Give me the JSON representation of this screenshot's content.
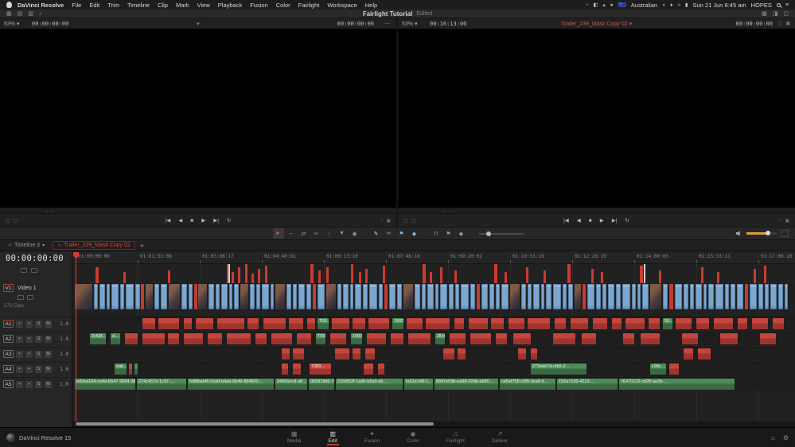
{
  "colors": {
    "accent": "#c9392c",
    "clip_blue": "#7ba6cd",
    "clip_red": "#c23c34",
    "clip_green": "#4d8c57",
    "volume_orange": "#de9a3f",
    "active_tab_red": "#cf4a3e"
  },
  "glyphs": {
    "caret": "▾",
    "dots": "⋯",
    "plus": "+",
    "close": "✕",
    "menu": "≡",
    "scrub": "‹ ›",
    "box": "▢",
    "circle": "○",
    "square": "▣"
  },
  "menubar": {
    "items": [
      "DaVinci Resolve",
      "File",
      "Edit",
      "Trim",
      "Timeline",
      "Clip",
      "Mark",
      "View",
      "Playback",
      "Fusion",
      "Color",
      "Fairlight",
      "Workspace",
      "Help"
    ],
    "status_icons_a": [
      {
        "name": "time-machine-icon",
        "glyph": "◔"
      },
      {
        "name": "display-icon",
        "glyph": "◧"
      },
      {
        "name": "dropbox-icon",
        "glyph": "▴"
      },
      {
        "name": "vpn-status-icon",
        "glyph": "●"
      }
    ],
    "region": "Australian",
    "status_icons_b": [
      {
        "name": "volume-icon",
        "glyph": "◖"
      },
      {
        "name": "bluetooth-icon",
        "glyph": "♦"
      },
      {
        "name": "wifi-icon",
        "glyph": "≈"
      },
      {
        "name": "battery-icon",
        "glyph": "▮"
      }
    ],
    "datetime": "Sun 21 Jun 8:45 am",
    "user": "HOPES"
  },
  "titlebar": {
    "title": "Fairlight Tutorial",
    "status": "Edited",
    "left_icons": [
      {
        "name": "media-pool-icon",
        "glyph": "▦"
      },
      {
        "name": "effects-library-icon",
        "glyph": "▤"
      },
      {
        "name": "edit-index-icon",
        "glyph": "▥"
      },
      {
        "name": "sound-library-icon",
        "glyph": "♪"
      }
    ],
    "right_icons": [
      {
        "name": "mixer-icon",
        "glyph": "▩"
      },
      {
        "name": "metadata-icon",
        "glyph": "◨"
      },
      {
        "name": "inspector-icon",
        "glyph": "◫"
      }
    ]
  },
  "viewers": {
    "left": {
      "zoom": "53%",
      "tc_in": "00:00:00:00",
      "tc_out": "00:00:00:00"
    },
    "right": {
      "zoom": "53%",
      "tc_in": "00:16:13:06",
      "clip": "Trailer_239_Mask Copy 02",
      "tc_out": "00:00:00:00"
    }
  },
  "transport": [
    {
      "name": "jump-to-start-button",
      "glyph": "|◀"
    },
    {
      "name": "step-back-button",
      "glyph": "◀"
    },
    {
      "name": "stop-button",
      "glyph": "■"
    },
    {
      "name": "play-button",
      "glyph": "▶"
    },
    {
      "name": "step-forward-button",
      "glyph": "▶|"
    },
    {
      "name": "loop-button",
      "glyph": "↻"
    }
  ],
  "toolbar": {
    "tools": [
      {
        "name": "selection-mode-tool",
        "glyph": "►",
        "color": "#d6594c",
        "active": true
      },
      {
        "name": "trim-edit-mode-tool",
        "glyph": "↔"
      },
      {
        "name": "dynamic-trim-mode-tool",
        "glyph": "⇄"
      },
      {
        "name": "blade-edit-mode-tool",
        "glyph": "✄"
      },
      {
        "name": "insert-clip-button",
        "glyph": "↓"
      },
      {
        "name": "overwrite-clip-button",
        "glyph": "▼"
      },
      {
        "name": "replace-clip-button",
        "glyph": "◉"
      },
      {
        "name": "pen-keyframe-tool",
        "glyph": "✎",
        "color": "#d8d8d8",
        "gap": true
      },
      {
        "name": "link-clips-toggle",
        "glyph": "∞",
        "color": "#86b6e8"
      },
      {
        "name": "flag-clip-button",
        "glyph": "⚑",
        "color": "#86b6e8"
      },
      {
        "name": "marker-button",
        "glyph": "◆",
        "color": "#86b6e8"
      },
      {
        "name": "snapping-toggle",
        "glyph": "⊓",
        "gap": true
      },
      {
        "name": "flag-color-button",
        "glyph": "⚑"
      },
      {
        "name": "marker-color-button",
        "glyph": "◆"
      }
    ]
  },
  "tabs": [
    {
      "label": "Timeline 3",
      "active": false
    },
    {
      "label": "Trailer_239_Mask Copy 02",
      "active": true
    }
  ],
  "timeline": {
    "timecode": "00:00:00:00",
    "ruler": [
      "01:00:00:00",
      "01:01:33:08",
      "01:03:06:17",
      "01:04:40:01",
      "01:06:13:10",
      "01:07:46:18",
      "01:09:20:02",
      "01:10:53:10",
      "01:12:26:19",
      "01:14:00:03",
      "01:15:33:11",
      "01:17:06:20"
    ],
    "video_track": {
      "badge": "V1",
      "name": "Video 1",
      "clip_count": "175 Clips"
    },
    "track_buttons": [
      {
        "name": "lock",
        "glyph": "•"
      },
      {
        "name": "record-arm",
        "glyph": "▪"
      },
      {
        "name": "solo",
        "glyph": "S"
      },
      {
        "name": "mute",
        "glyph": "M"
      }
    ],
    "audio_tracks": [
      {
        "badge": "A1",
        "gain": "1.0",
        "selected": true
      },
      {
        "badge": "A2",
        "gain": "1.0",
        "selected": false
      },
      {
        "badge": "A3",
        "gain": "1.0",
        "selected": false
      },
      {
        "badge": "A4",
        "gain": "1.0",
        "selected": false
      },
      {
        "badge": "A5",
        "gain": "1.0",
        "selected": false
      }
    ],
    "markers": [
      [
        29,
        4,
        20
      ],
      [
        64,
        3,
        14
      ],
      [
        120,
        3,
        16
      ],
      [
        194,
        4,
        24
      ],
      [
        200,
        3,
        14
      ],
      [
        208,
        3,
        20
      ],
      [
        217,
        3,
        24
      ],
      [
        225,
        3,
        12
      ],
      [
        233,
        3,
        18
      ],
      [
        242,
        3,
        22
      ],
      [
        299,
        4,
        24
      ],
      [
        309,
        3,
        16
      ],
      [
        319,
        3,
        20
      ],
      [
        350,
        3,
        24
      ],
      [
        360,
        3,
        14
      ],
      [
        368,
        3,
        18
      ],
      [
        390,
        3,
        22
      ],
      [
        440,
        4,
        24
      ],
      [
        449,
        3,
        14
      ],
      [
        462,
        3,
        20
      ],
      [
        480,
        3,
        16
      ],
      [
        530,
        4,
        24
      ],
      [
        543,
        3,
        14
      ],
      [
        570,
        3,
        20
      ],
      [
        592,
        3,
        16
      ],
      [
        622,
        4,
        24
      ],
      [
        652,
        3,
        18
      ],
      [
        664,
        3,
        14
      ],
      [
        713,
        4,
        22
      ],
      [
        737,
        3,
        16
      ],
      [
        790,
        3,
        20
      ],
      [
        810,
        3,
        14
      ],
      [
        856,
        3,
        18
      ],
      [
        869,
        3,
        22
      ]
    ],
    "markers_light": [
      [
        196,
        2,
        24
      ],
      [
        718,
        2,
        24
      ]
    ],
    "video_clips": [
      [
        3,
        22,
        "t"
      ],
      [
        27,
        5,
        "b"
      ],
      [
        34,
        7,
        "b"
      ],
      [
        43,
        4,
        "b"
      ],
      [
        49,
        9,
        "b"
      ],
      [
        60,
        5,
        "b"
      ],
      [
        67,
        10,
        "b"
      ],
      [
        79,
        6,
        "b"
      ],
      [
        86,
        4,
        "r"
      ],
      [
        92,
        9,
        "t"
      ],
      [
        103,
        6,
        "b"
      ],
      [
        111,
        8,
        "b"
      ],
      [
        121,
        14,
        "t"
      ],
      [
        137,
        7,
        "b"
      ],
      [
        146,
        5,
        "b"
      ],
      [
        153,
        4,
        "r"
      ],
      [
        158,
        11,
        "t"
      ],
      [
        171,
        7,
        "b"
      ],
      [
        180,
        5,
        "b"
      ],
      [
        187,
        8,
        "b"
      ],
      [
        197,
        4,
        "b"
      ],
      [
        203,
        6,
        "b"
      ],
      [
        211,
        10,
        "t"
      ],
      [
        223,
        6,
        "b"
      ],
      [
        231,
        5,
        "b"
      ],
      [
        238,
        9,
        "b"
      ],
      [
        249,
        4,
        "b"
      ],
      [
        255,
        12,
        "t"
      ],
      [
        269,
        6,
        "b"
      ],
      [
        277,
        5,
        "b"
      ],
      [
        284,
        8,
        "b"
      ],
      [
        294,
        6,
        "b"
      ],
      [
        302,
        4,
        "r"
      ],
      [
        308,
        9,
        "b"
      ],
      [
        319,
        12,
        "t"
      ],
      [
        333,
        5,
        "b"
      ],
      [
        340,
        7,
        "b"
      ],
      [
        349,
        4,
        "b"
      ],
      [
        355,
        8,
        "b"
      ],
      [
        365,
        6,
        "b"
      ],
      [
        373,
        10,
        "b"
      ],
      [
        385,
        5,
        "b"
      ],
      [
        392,
        4,
        "r"
      ],
      [
        398,
        8,
        "b"
      ],
      [
        408,
        6,
        "b"
      ],
      [
        416,
        12,
        "t"
      ],
      [
        430,
        7,
        "b"
      ],
      [
        439,
        5,
        "b"
      ],
      [
        446,
        8,
        "b"
      ],
      [
        456,
        4,
        "b"
      ],
      [
        462,
        9,
        "b"
      ],
      [
        473,
        6,
        "b"
      ],
      [
        481,
        5,
        "b"
      ],
      [
        488,
        10,
        "b"
      ],
      [
        500,
        6,
        "b"
      ],
      [
        508,
        4,
        "r"
      ],
      [
        514,
        8,
        "b"
      ],
      [
        524,
        6,
        "b"
      ],
      [
        532,
        5,
        "b"
      ],
      [
        539,
        9,
        "b"
      ],
      [
        550,
        12,
        "t"
      ],
      [
        564,
        6,
        "b"
      ],
      [
        572,
        5,
        "b"
      ],
      [
        579,
        8,
        "b"
      ],
      [
        589,
        4,
        "b"
      ],
      [
        595,
        7,
        "b"
      ],
      [
        604,
        10,
        "b"
      ],
      [
        616,
        5,
        "b"
      ],
      [
        623,
        6,
        "b"
      ],
      [
        631,
        8,
        "t"
      ],
      [
        641,
        4,
        "r"
      ],
      [
        647,
        9,
        "b"
      ],
      [
        658,
        6,
        "b"
      ],
      [
        666,
        5,
        "b"
      ],
      [
        673,
        8,
        "b"
      ],
      [
        683,
        6,
        "b"
      ],
      [
        691,
        10,
        "b"
      ],
      [
        703,
        5,
        "b"
      ],
      [
        710,
        4,
        "b"
      ],
      [
        716,
        8,
        "b"
      ],
      [
        726,
        14,
        "t"
      ],
      [
        742,
        6,
        "b"
      ],
      [
        750,
        5,
        "r"
      ],
      [
        757,
        9,
        "b"
      ],
      [
        768,
        6,
        "b"
      ],
      [
        776,
        5,
        "b"
      ],
      [
        783,
        8,
        "b"
      ],
      [
        793,
        4,
        "b"
      ],
      [
        799,
        7,
        "b"
      ],
      [
        808,
        10,
        "b"
      ],
      [
        820,
        5,
        "b"
      ],
      [
        827,
        6,
        "b"
      ],
      [
        835,
        8,
        "b"
      ],
      [
        845,
        4,
        "r"
      ],
      [
        851,
        9,
        "b"
      ],
      [
        862,
        6,
        "b"
      ],
      [
        870,
        5,
        "b"
      ],
      [
        877,
        8,
        "b"
      ],
      [
        887,
        6,
        "b"
      ],
      [
        895,
        4,
        "b"
      ]
    ],
    "audio_clips": {
      "a1": [
        [
          88,
          16,
          "r"
        ],
        [
          108,
          26,
          "r"
        ],
        [
          140,
          10,
          "r"
        ],
        [
          155,
          22,
          "r"
        ],
        [
          182,
          34,
          "r"
        ],
        [
          220,
          14,
          "r"
        ],
        [
          240,
          28,
          "r"
        ],
        [
          272,
          18,
          "r"
        ],
        [
          295,
          10,
          "r"
        ],
        [
          308,
          14,
          "g",
          "T03..."
        ],
        [
          326,
          22,
          "r"
        ],
        [
          352,
          16,
          "r"
        ],
        [
          372,
          26,
          "r"
        ],
        [
          402,
          14,
          "g",
          "1902..."
        ],
        [
          420,
          20,
          "r"
        ],
        [
          444,
          30,
          "r"
        ],
        [
          480,
          12,
          "r"
        ],
        [
          498,
          24,
          "r"
        ],
        [
          526,
          16,
          "r"
        ],
        [
          548,
          20,
          "r"
        ],
        [
          572,
          28,
          "r"
        ],
        [
          606,
          14,
          "r"
        ],
        [
          626,
          22,
          "r"
        ],
        [
          654,
          18,
          "r"
        ],
        [
          678,
          12,
          "r"
        ],
        [
          695,
          24,
          "r"
        ],
        [
          724,
          14,
          "r"
        ],
        [
          742,
          12,
          "g",
          "55..."
        ],
        [
          758,
          20,
          "r"
        ],
        [
          784,
          16,
          "r"
        ],
        [
          806,
          24,
          "r"
        ],
        [
          836,
          12,
          "r"
        ],
        [
          854,
          20,
          "r"
        ],
        [
          880,
          14,
          "r"
        ]
      ],
      "a2": [
        [
          22,
          20,
          "g",
          "2c66f..."
        ],
        [
          48,
          12,
          "g",
          "d..."
        ],
        [
          66,
          16,
          "r"
        ],
        [
          88,
          28,
          "r"
        ],
        [
          120,
          14,
          "r"
        ],
        [
          140,
          24,
          "r"
        ],
        [
          170,
          18,
          "r"
        ],
        [
          194,
          30,
          "r"
        ],
        [
          230,
          14,
          "r"
        ],
        [
          250,
          26,
          "r"
        ],
        [
          282,
          18,
          "r"
        ],
        [
          306,
          12,
          "g",
          "T03..."
        ],
        [
          324,
          20,
          "r"
        ],
        [
          350,
          14,
          "g",
          "1902..."
        ],
        [
          370,
          24,
          "r"
        ],
        [
          400,
          16,
          "r"
        ],
        [
          422,
          28,
          "r"
        ],
        [
          456,
          12,
          "g",
          "26c0..."
        ],
        [
          474,
          20,
          "r"
        ],
        [
          500,
          26,
          "r"
        ],
        [
          532,
          14,
          "r"
        ],
        [
          554,
          22,
          "r"
        ],
        [
          604,
          28,
          "r"
        ],
        [
          640,
          18,
          "r"
        ],
        [
          692,
          14,
          "r"
        ],
        [
          714,
          24,
          "r"
        ],
        [
          766,
          20,
          "r"
        ],
        [
          814,
          22,
          "r"
        ],
        [
          864,
          20,
          "r"
        ]
      ],
      "a3": [
        [
          263,
          10,
          "r"
        ],
        [
          277,
          14,
          "r"
        ],
        [
          330,
          18,
          "r"
        ],
        [
          352,
          10,
          "r"
        ],
        [
          368,
          12,
          "r"
        ],
        [
          466,
          14,
          "r"
        ],
        [
          484,
          10,
          "r"
        ],
        [
          560,
          10,
          "r"
        ],
        [
          576,
          8,
          "r"
        ],
        [
          768,
          12,
          "r"
        ],
        [
          786,
          16,
          "r"
        ]
      ],
      "a4": [
        [
          53,
          15,
          "g",
          "eab..."
        ],
        [
          71,
          4,
          "r"
        ],
        [
          78,
          4,
          "g"
        ],
        [
          263,
          8,
          "r"
        ],
        [
          277,
          10,
          "r"
        ],
        [
          298,
          27,
          "r",
          "7389..."
        ],
        [
          366,
          12,
          "r"
        ],
        [
          384,
          8,
          "r"
        ],
        [
          576,
          70,
          "g",
          "273eb67d-cfb5-2..."
        ],
        [
          726,
          20,
          "g",
          "c28c..."
        ],
        [
          750,
          12,
          "r"
        ]
      ],
      "a5": [
        [
          3,
          76,
          "g",
          "e42ea164-ce4a-b547-9994-3862..."
        ],
        [
          81,
          62,
          "g",
          "274c457d-1c97-..."
        ],
        [
          145,
          108,
          "g",
          "5d88ad46-0cdd-b4ab-0b49-884600..."
        ],
        [
          255,
          40,
          "g",
          "24665ecd-a8..."
        ],
        [
          297,
          32,
          "g",
          "065918d6-75..."
        ],
        [
          331,
          84,
          "g",
          "21b0f52f-1ad6-b5a9-a6..."
        ],
        [
          417,
          36,
          "g",
          "fa62e148-1..."
        ],
        [
          455,
          80,
          "g",
          "88d7e09b-ea98-92db-a680..."
        ],
        [
          537,
          70,
          "g",
          "ce5ef758-c0f9-3ea0-6..."
        ],
        [
          609,
          76,
          "g",
          "192a7165-4212-..."
        ],
        [
          687,
          145,
          "g",
          "76470122-cd28-ae2b-..."
        ]
      ]
    }
  },
  "pages": {
    "app": "DaVinci Resolve 15",
    "active": "Ed",
    "active_label": "Edit",
    "items": [
      {
        "label": "Media",
        "glyph": "▦"
      },
      {
        "label": "Edit",
        "glyph": "▥"
      },
      {
        "label": "Fusion",
        "glyph": "✦"
      },
      {
        "label": "Color",
        "glyph": "◉"
      },
      {
        "label": "Fairlight",
        "glyph": "♫"
      },
      {
        "label": "Deliver",
        "glyph": "↗"
      }
    ]
  }
}
